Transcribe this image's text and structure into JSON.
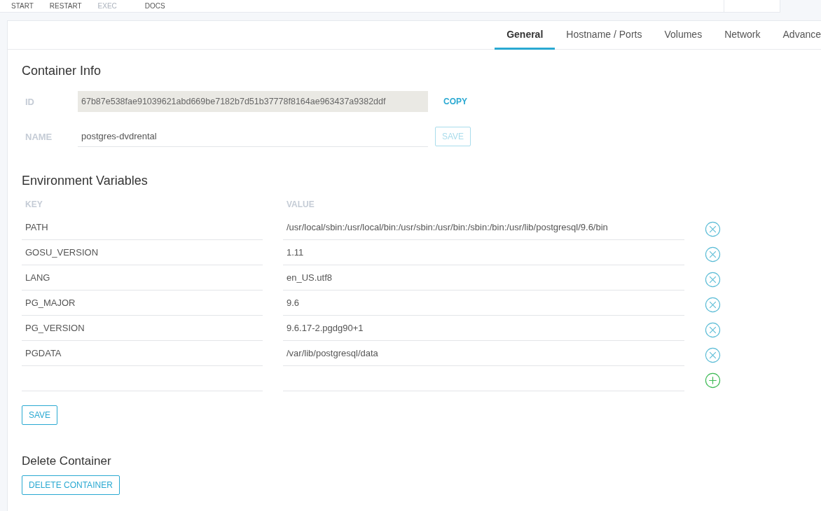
{
  "toolbar": [
    {
      "label": "START",
      "disabled": false
    },
    {
      "label": "RESTART",
      "disabled": false
    },
    {
      "label": "EXEC",
      "disabled": true
    },
    {
      "label": "DOCS",
      "disabled": false
    }
  ],
  "tabs": [
    {
      "label": "General",
      "selected": true
    },
    {
      "label": "Hostname / Ports",
      "selected": false
    },
    {
      "label": "Volumes",
      "selected": false
    },
    {
      "label": "Network",
      "selected": false
    },
    {
      "label": "Advance",
      "selected": false
    }
  ],
  "container_info": {
    "title": "Container Info",
    "id": {
      "label": "ID",
      "value": "67b87e538fae91039621abd669be7182b7d51b37778f8164ae963437a9382ddf",
      "button": {
        "label": "COPY",
        "disabled": false
      }
    },
    "name": {
      "label": "NAME",
      "value": "postgres-dvdrental",
      "button": {
        "label": "SAVE",
        "disabled": true
      }
    }
  },
  "environment": {
    "title": "Environment Variables",
    "columns": [
      "KEY",
      "VALUE"
    ],
    "rows": [
      {
        "key": "PATH",
        "value": "/usr/local/sbin:/usr/local/bin:/usr/sbin:/usr/bin:/sbin:/bin:/usr/lib/postgresql/9.6/bin",
        "kind": "existing"
      },
      {
        "key": "GOSU_VERSION",
        "value": "1.11",
        "kind": "existing"
      },
      {
        "key": "LANG",
        "value": "en_US.utf8",
        "kind": "existing"
      },
      {
        "key": "PG_MAJOR",
        "value": "9.6",
        "kind": "existing"
      },
      {
        "key": "PG_VERSION",
        "value": "9.6.17-2.pgdg90+1",
        "kind": "existing"
      },
      {
        "key": "PGDATA",
        "value": "/var/lib/postgresql/data",
        "kind": "existing"
      },
      {
        "key": "",
        "value": "",
        "kind": "new"
      }
    ],
    "save_button": {
      "label": "SAVE",
      "disabled": false
    }
  },
  "delete": {
    "title": "Delete Container",
    "button": {
      "label": "DELETE CONTAINER",
      "disabled": false
    }
  }
}
